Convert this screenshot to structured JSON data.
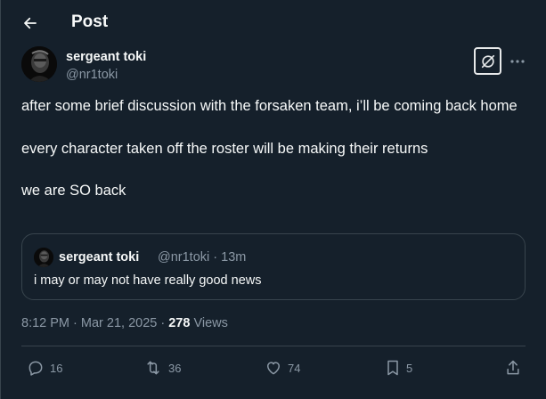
{
  "header": {
    "title": "Post"
  },
  "author": {
    "name": "sergeant toki",
    "handle": "@nr1toki"
  },
  "tweet": {
    "paragraphs": [
      "after some brief discussion with the forsaken team, i’ll be coming back home",
      "every character taken off the roster will be making their returns",
      "we are SO back"
    ]
  },
  "quote": {
    "name": "sergeant toki",
    "meta": "@nr1toki · 13m",
    "text": "i may or may not have really good news"
  },
  "meta": {
    "timestamp": "8:12 PM · Mar 21, 2025 · ",
    "views_count": "278",
    "views_label": " Views"
  },
  "actions": {
    "replies": "16",
    "reposts": "36",
    "likes": "74",
    "bookmarks": "5"
  },
  "colors": {
    "background": "#15202b",
    "text": "#f7f9f9",
    "secondary": "#8b98a5",
    "border": "#38444d"
  }
}
